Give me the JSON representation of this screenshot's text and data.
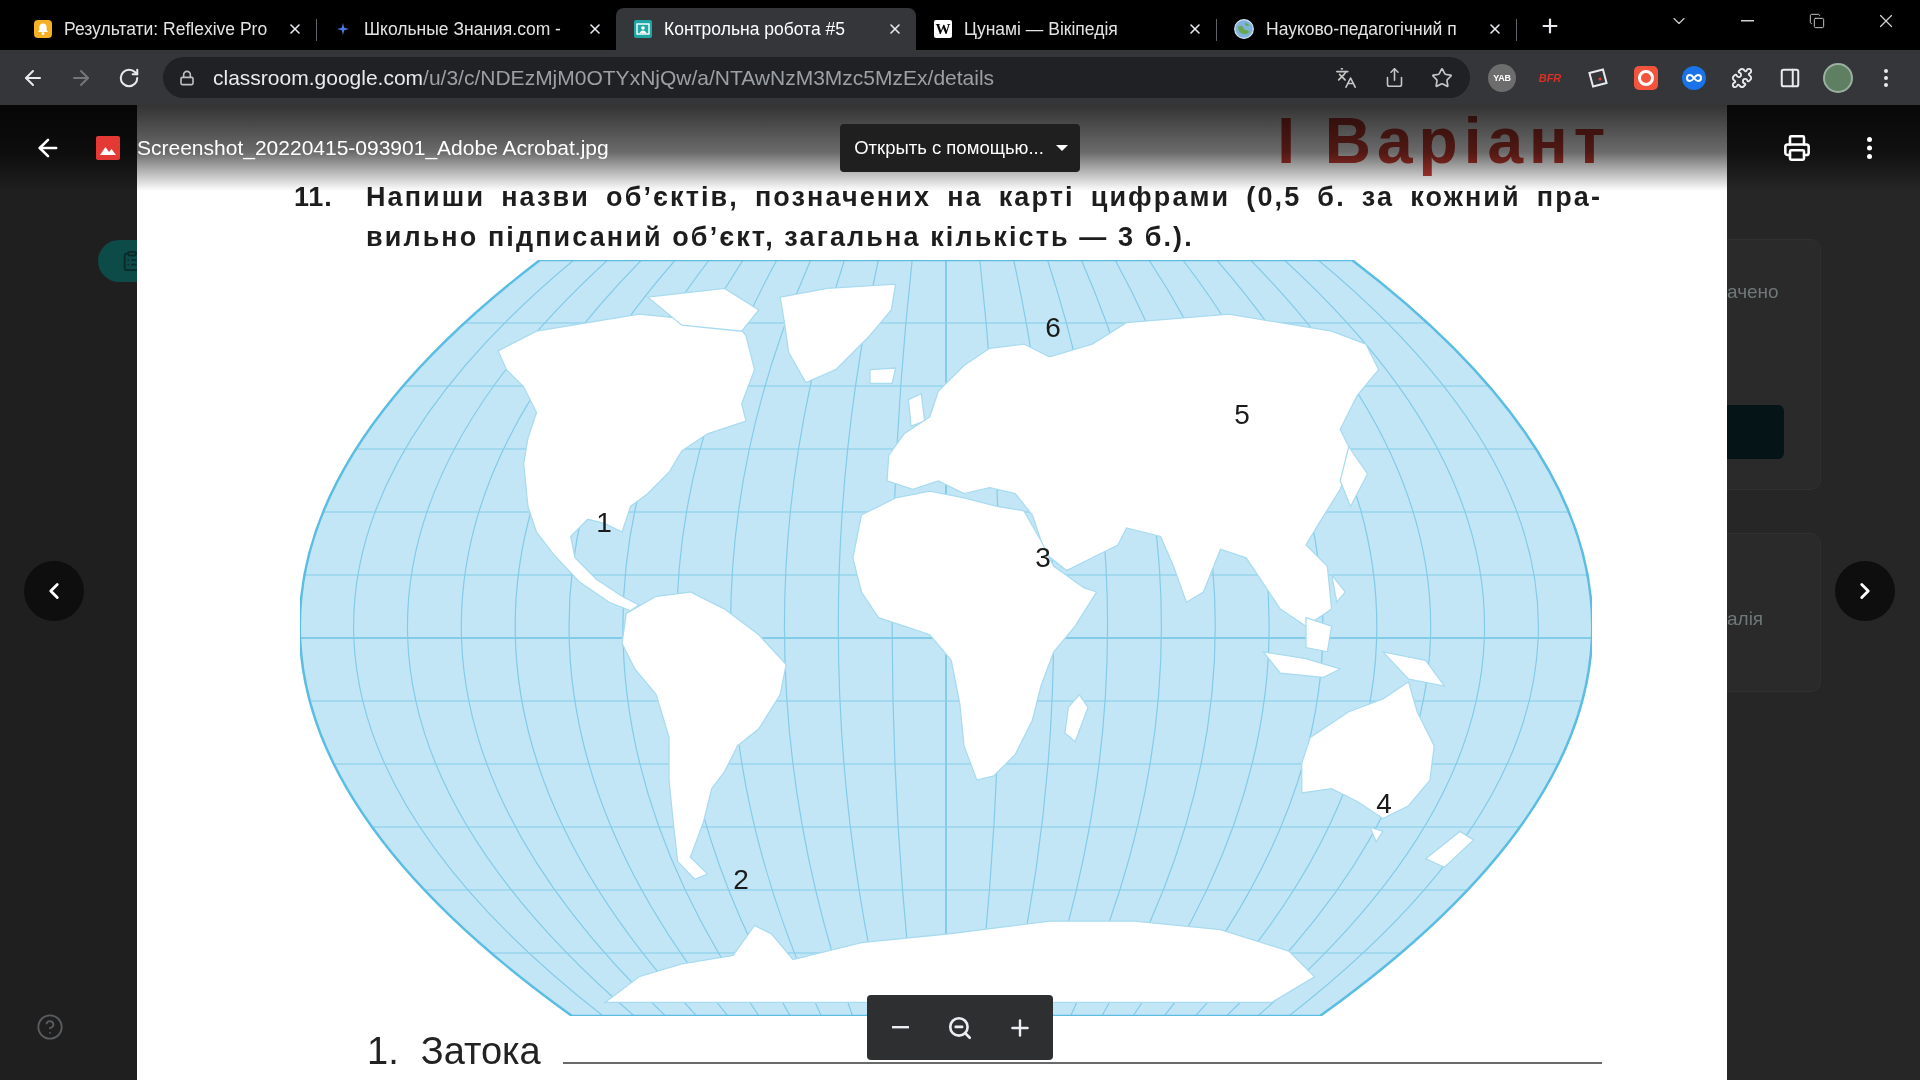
{
  "tabs": [
    {
      "title": "Результати: Reflexive Pro",
      "selected": false
    },
    {
      "title": "Школьные Знания.com -",
      "selected": false
    },
    {
      "title": "Контрольна робота #5",
      "selected": true
    },
    {
      "title": "Цунамі — Вікіпедія",
      "selected": false,
      "favicon_letter": "W"
    },
    {
      "title": "Науково-педагогічний п",
      "selected": false
    }
  ],
  "nav": {
    "back_disabled": false,
    "forward_disabled": true
  },
  "address_bar": {
    "host": "classroom.google.com",
    "path": "/u/3/c/NDEzMjM0OTYxNjQw/a/NTAwNzM3Mzc5MzEx/details"
  },
  "extension_badges": [
    {
      "kind": "disc",
      "label": "YAB"
    },
    {
      "kind": "plain",
      "label": "BFR"
    }
  ],
  "viewer": {
    "file_name": "Screenshot_20220415-093901_Adobe Acrobat.jpg",
    "open_with": "Открыть с помощью..."
  },
  "document": {
    "heading": "І Варіант",
    "question": {
      "number": "11.",
      "lines": [
        "Напиши назви об’єктів, позначених на карті цифрами (0,5 б. за кожний пра-",
        "вильно підписаний об’єкт, загальна кількість — 3 б.)."
      ]
    },
    "map_labels": [
      "1",
      "2",
      "3",
      "4",
      "5",
      "6"
    ],
    "answers": [
      {
        "number": "1.",
        "label": "Затока"
      }
    ]
  },
  "background_cards": [
    {
      "kind": "with-button",
      "label": "ачено"
    },
    {
      "kind": "plain",
      "label": "алія"
    }
  ]
}
